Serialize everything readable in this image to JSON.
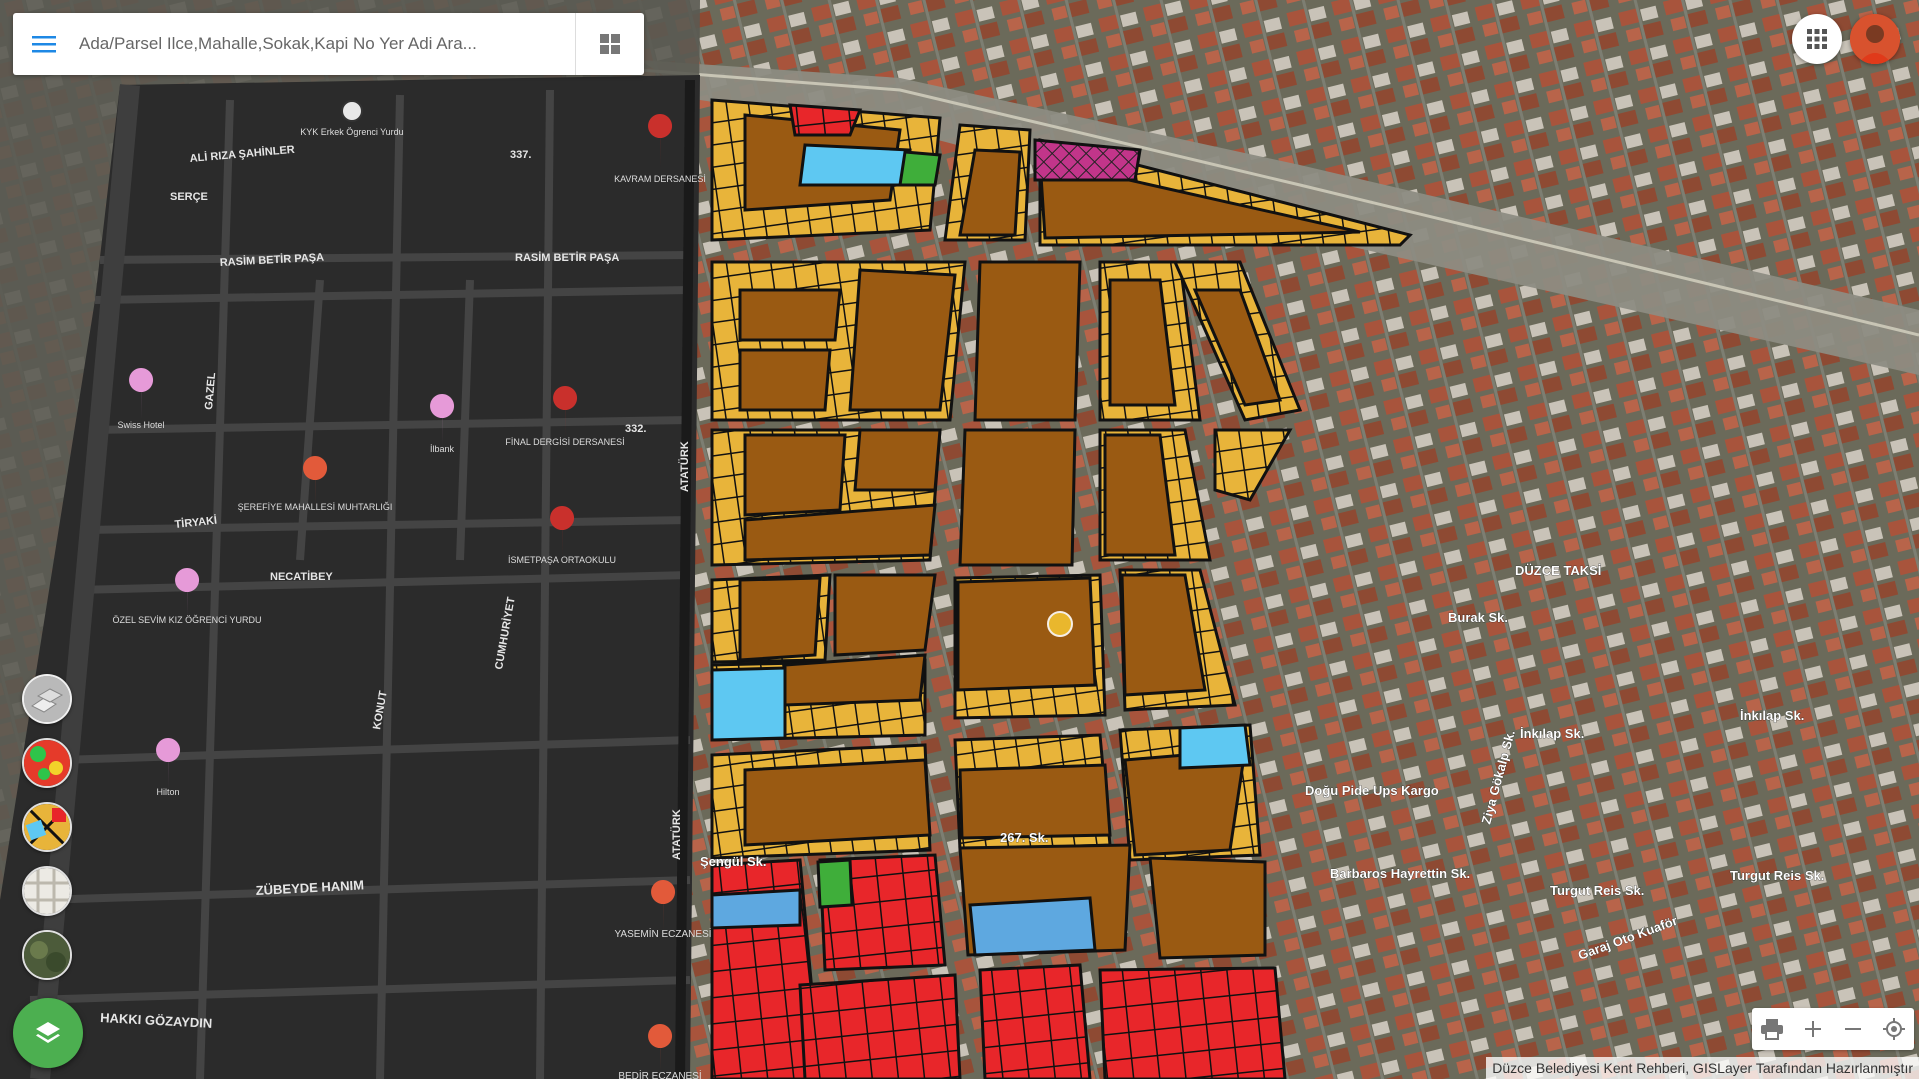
{
  "search": {
    "placeholder": "Ada/Parsel Ilce,Mahalle,Sokak,Kapi No Yer Adi Ara..."
  },
  "icons": {
    "menu": "menu-icon",
    "grid_view": "grid-view-icon",
    "apps": "apps-grid-icon",
    "layers": "layers-icon",
    "print": "print-icon",
    "zoom_in": "zoom-in-icon",
    "zoom_out": "zoom-out-icon",
    "locate": "my-location-icon"
  },
  "colors": {
    "parcel_brown": "#9a5a12",
    "parcel_yellow": "#e8b43a",
    "parcel_red": "#e8262a",
    "parcel_blue": "#5ec8f2",
    "parcel_green": "#3fae3a",
    "parcel_pink": "#c2358a",
    "fab_green": "#4caf50",
    "dark_map": "#2b2b2b"
  },
  "pois": [
    {
      "name": "KYK Erkek Ögrenci Yurdu"
    },
    {
      "name": "KAVRAM DERSANESİ"
    },
    {
      "name": "Swiss Hotel"
    },
    {
      "name": "İlbank"
    },
    {
      "name": "FİNAL DERGİSİ DERSANESİ"
    },
    {
      "name": "ŞEREFİYE MAHALLESİ MUHTARLIĞI"
    },
    {
      "name": "İSMETPAŞA ORTAOKULU"
    },
    {
      "name": "ÖZEL SEVİM KIZ ÖĞRENCİ YURDU"
    },
    {
      "name": "Hilton"
    },
    {
      "name": "YASEMİN ECZANESİ"
    },
    {
      "name": "BEDİR ECZANESİ"
    }
  ],
  "streets": {
    "rasim_betir": "RASİM BETİR PAŞA",
    "ali_riza": "ALİ RIZA ŞAHİNLER",
    "serce": "SERÇE",
    "tiryaki": "TİRYAKİ",
    "necatibey": "NECATİBEY",
    "cumhuriyet": "CUMHURİYET",
    "konut": "KONUT",
    "ataturk": "ATATÜRK",
    "zubeyde": "ZÜBEYDE HANIM",
    "hakki": "HAKKI GÖZAYDIN",
    "gazel": "GAZEL",
    "number_332": "332.",
    "number_337": "337.",
    "barbaros": "Barbaros Hayrettin Sk.",
    "turgut_reis": "Turgut Reis Sk.",
    "inkilap": "İnkılap Sk.",
    "burak": "Burak Sk.",
    "ziya_gokalp": "Ziya Gökalp Sk.",
    "sk_267": "267. Sk.",
    "sengul": "Şengül Sk.",
    "ups": "Ups Kargo",
    "dogu_pide": "Doğu Pide",
    "garaj": "Garaj Oto Kuaför",
    "duzce_taksi": "DÜZCE TAKSİ"
  },
  "attribution": "Düzce Belediyesi Kent Rehberi, GISLayer Tarafından Hazırlanmıştır"
}
